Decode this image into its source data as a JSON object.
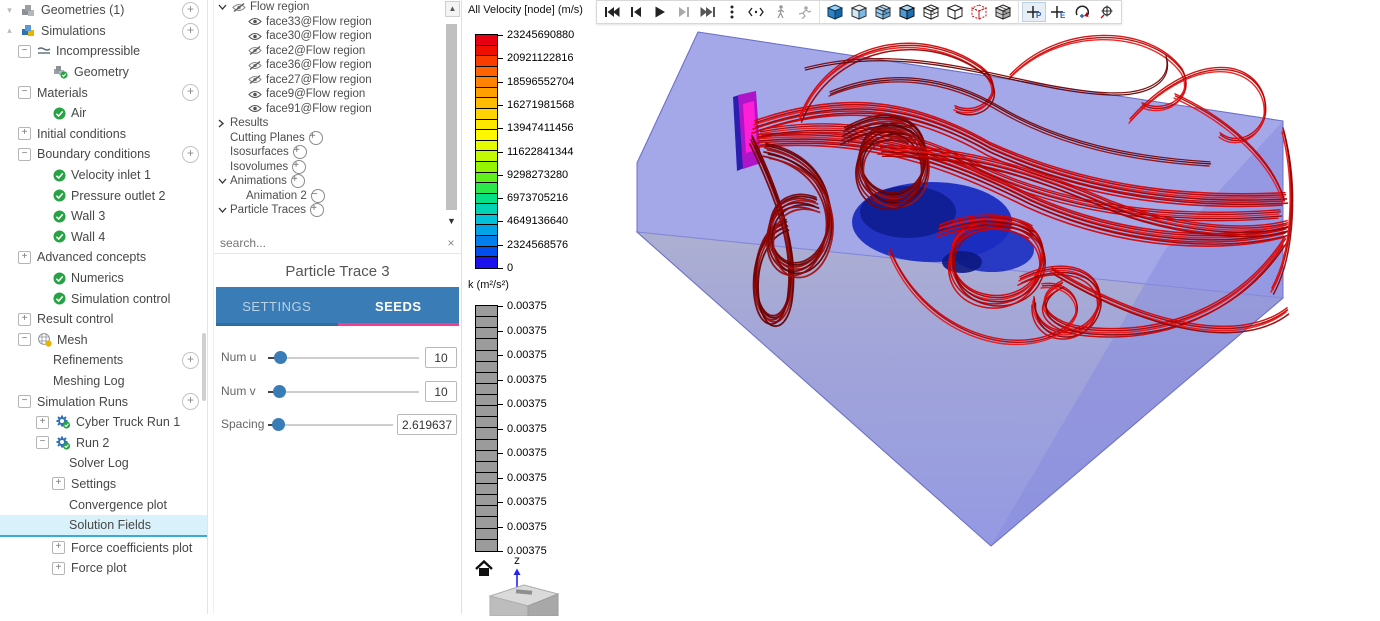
{
  "sidebar": {
    "items": [
      {
        "label": "Geometries (1)",
        "indent": 0,
        "expander": "chevron-dim-down",
        "icon": "cubes-gray",
        "plus": true
      },
      {
        "label": "Simulations",
        "indent": 0,
        "expander": "chevron-dim-up",
        "icon": "cubes-color",
        "plus": true
      },
      {
        "label": "Incompressible",
        "indent": 1,
        "expander": "minus-box",
        "icon": "flow-lines"
      },
      {
        "label": "Geometry",
        "indent": 2,
        "icon": "cubes-check"
      },
      {
        "label": "Materials",
        "indent": 1,
        "expander": "minus-box",
        "plus": true
      },
      {
        "label": "Air",
        "indent": 2,
        "icon": "check"
      },
      {
        "label": "Initial conditions",
        "indent": 1,
        "expander": "plus-box"
      },
      {
        "label": "Boundary conditions",
        "indent": 1,
        "expander": "minus-box",
        "plus": true
      },
      {
        "label": "Velocity inlet 1",
        "indent": 2,
        "icon": "check"
      },
      {
        "label": "Pressure outlet 2",
        "indent": 2,
        "icon": "check"
      },
      {
        "label": "Wall 3",
        "indent": 2,
        "icon": "check"
      },
      {
        "label": "Wall 4",
        "indent": 2,
        "icon": "check"
      },
      {
        "label": "Advanced concepts",
        "indent": 1,
        "expander": "plus-box"
      },
      {
        "label": "Numerics",
        "indent": 2,
        "icon": "check"
      },
      {
        "label": "Simulation control",
        "indent": 2,
        "icon": "check"
      },
      {
        "label": "Result control",
        "indent": 1,
        "expander": "plus-box"
      },
      {
        "label": "Mesh",
        "indent": 1,
        "expander": "minus-box",
        "icon": "mesh-warn"
      },
      {
        "label": "Refinements",
        "indent": 2,
        "plus": true
      },
      {
        "label": "Meshing Log",
        "indent": 2
      },
      {
        "label": "Simulation Runs",
        "indent": 1,
        "expander": "minus-box",
        "plus": true
      },
      {
        "label": "Cyber Truck Run 1",
        "indent": 2,
        "expander": "plus-box",
        "icon": "gear-check"
      },
      {
        "label": "Run 2",
        "indent": 2,
        "expander": "minus-box",
        "icon": "gear-check"
      },
      {
        "label": "Solver Log",
        "indent": 3
      },
      {
        "label": "Settings",
        "indent": 3,
        "expander": "plus-box"
      },
      {
        "label": "Convergence plot",
        "indent": 3
      },
      {
        "label": "Solution Fields",
        "indent": 3,
        "selected": true
      },
      {
        "label": "Force coefficients plot",
        "indent": 3,
        "expander": "plus-box"
      },
      {
        "label": "Force plot",
        "indent": 3,
        "expander": "plus-box"
      }
    ]
  },
  "scene_tree": {
    "items": [
      {
        "label": "Flow region",
        "indent": 0,
        "chevron": "down",
        "icon": "eye-off"
      },
      {
        "label": "face33@Flow region",
        "indent": 1,
        "icon": "eye"
      },
      {
        "label": "face30@Flow region",
        "indent": 1,
        "icon": "eye"
      },
      {
        "label": "face2@Flow region",
        "indent": 1,
        "icon": "eye-off"
      },
      {
        "label": "face36@Flow region",
        "indent": 1,
        "icon": "eye-off"
      },
      {
        "label": "face27@Flow region",
        "indent": 1,
        "icon": "eye-off"
      },
      {
        "label": "face9@Flow region",
        "indent": 1,
        "icon": "eye"
      },
      {
        "label": "face91@Flow region",
        "indent": 1,
        "icon": "eye"
      },
      {
        "label": "Results",
        "indent": 0,
        "chevron": "right"
      },
      {
        "label": "Cutting Planes",
        "indent": 0,
        "suffix": "oplus"
      },
      {
        "label": "Isosurfaces",
        "indent": 0,
        "suffix": "oplus"
      },
      {
        "label": "Isovolumes",
        "indent": 0,
        "suffix": "oplus"
      },
      {
        "label": "Animations",
        "indent": 0,
        "chevron": "down",
        "suffix": "oplus"
      },
      {
        "label": "Animation 2",
        "indent": 1,
        "suffix": "ominus"
      },
      {
        "label": "Particle Traces",
        "indent": 0,
        "chevron": "down",
        "suffix": "oplus"
      }
    ],
    "search_placeholder": "search...",
    "close_glyph": "×"
  },
  "particle_panel": {
    "title": "Particle Trace 3",
    "tabs": [
      {
        "label": "SETTINGS",
        "active": false
      },
      {
        "label": "SEEDS",
        "active": true
      }
    ],
    "sliders": [
      {
        "label": "Num u",
        "value": "10",
        "pos": 0.08
      },
      {
        "label": "Num v",
        "value": "10",
        "pos": 0.07
      },
      {
        "label": "Spacing",
        "value": "2.619637",
        "pos": 0.08
      }
    ]
  },
  "legend_velocity": {
    "title": "All Velocity [node] (m/s)",
    "ticks": [
      "23245690880",
      "20921122816",
      "18596552704",
      "16271981568",
      "13947411456",
      "11622841344",
      "9298273280",
      "6973705216",
      "4649136640",
      "2324568576",
      "0"
    ],
    "colors": [
      "#e70012",
      "#ee0f00",
      "#fb3c00",
      "#ff6400",
      "#ff8300",
      "#ffa000",
      "#ffbb00",
      "#ffd300",
      "#ffe800",
      "#fdf800",
      "#e5fb00",
      "#c2f800",
      "#95f400",
      "#60ee1f",
      "#2ce74c",
      "#06df84",
      "#00d3b4",
      "#00c1d9",
      "#00a4e6",
      "#007fec",
      "#004df0",
      "#1a11ee"
    ]
  },
  "legend_k": {
    "title": "k (m²/s²)",
    "ticks": [
      "0.00375",
      "0.00375",
      "0.00375",
      "0.00375",
      "0.00375",
      "0.00375",
      "0.00375",
      "0.00375",
      "0.00375",
      "0.00375",
      "0.00375"
    ],
    "cell_color": "#9b9b9b"
  },
  "toolbar": {
    "groups": [
      [
        "skip-start",
        "step-back",
        "play",
        "step-forward",
        "skip-end",
        "dots-vertical",
        "trace-extent",
        "walk-mode",
        "run-mode"
      ],
      [
        "cube-solid",
        "cube-shaded",
        "cube-grid",
        "cube-blue",
        "cube-wire-grid",
        "cube-wire",
        "cube-points",
        "cube-bw"
      ],
      [
        "probe-point-p",
        "probe-point-e",
        "rotate-free",
        "pick-target"
      ]
    ],
    "pressed": "probe-point-p"
  },
  "axis_widget": {
    "axis_label": "z"
  },
  "colors": {
    "accent_blue": "#3a7cb5",
    "tab_pink": "#f53d8f",
    "selection": "#d9f1fb",
    "check_green": "#27a344"
  }
}
